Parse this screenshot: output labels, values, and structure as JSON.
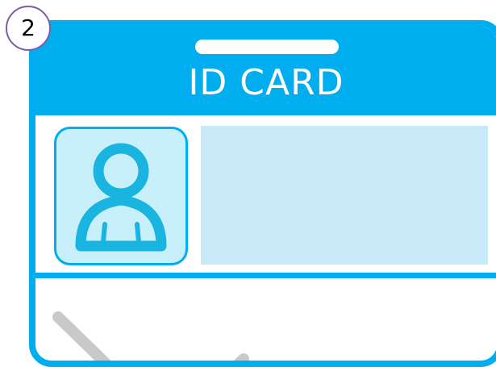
{
  "badge": {
    "number": "2"
  },
  "card": {
    "title": "ID CARD",
    "icons": {
      "photo": "person-silhouette-icon"
    }
  },
  "colors": {
    "accent": "#00adef",
    "photo_background": "#c8f0fb",
    "info_box": "#c8e9f8",
    "badge_border": "#7b5ea8"
  }
}
